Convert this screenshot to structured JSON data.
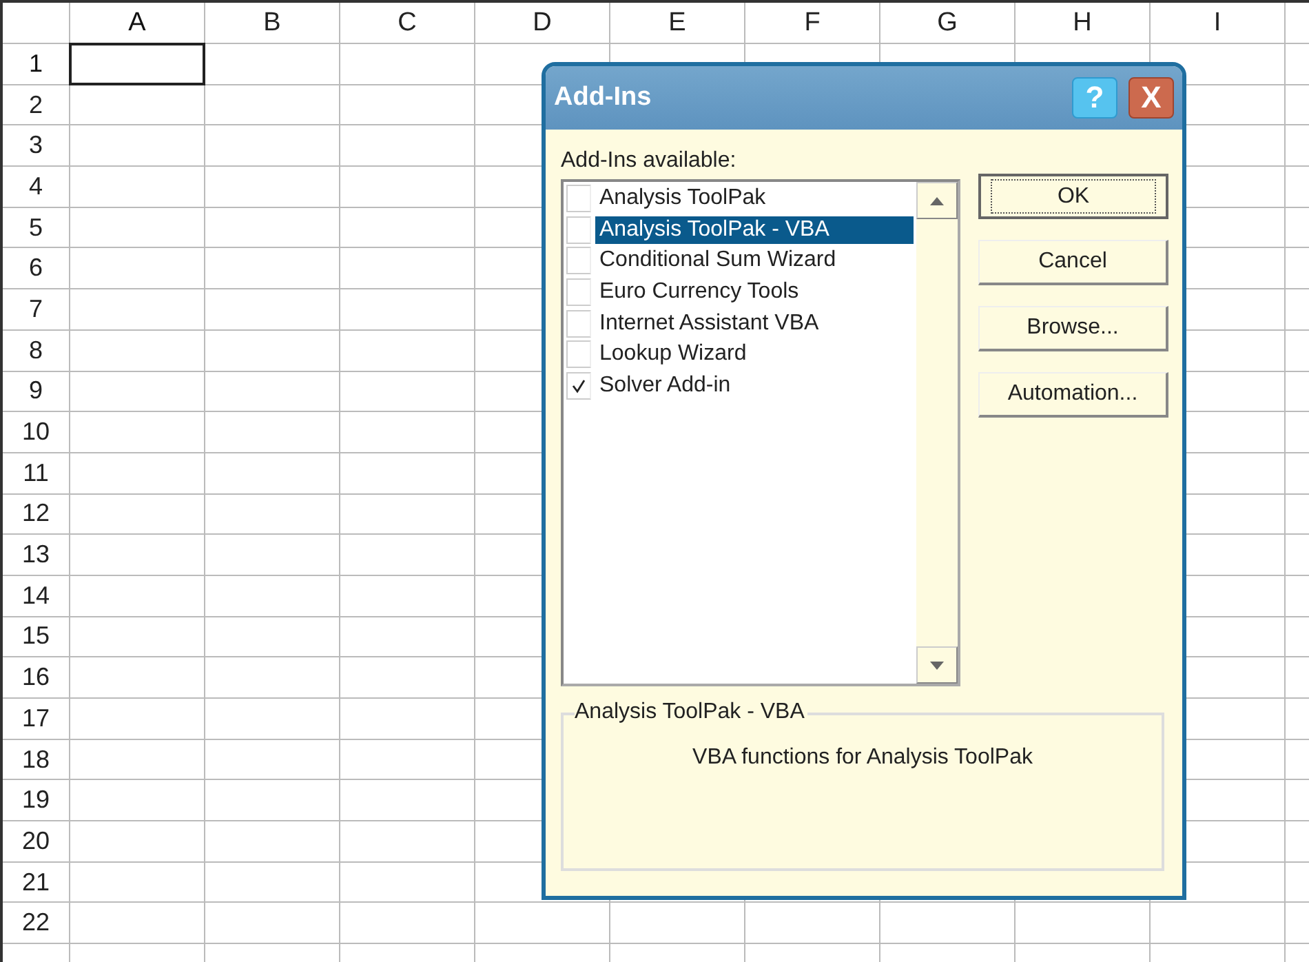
{
  "sheet": {
    "columns": [
      {
        "label": "A",
        "selected": true
      },
      {
        "label": "B",
        "selected": false
      },
      {
        "label": "C",
        "selected": false
      },
      {
        "label": "D",
        "selected": false
      },
      {
        "label": "E",
        "selected": false
      },
      {
        "label": "F",
        "selected": false
      },
      {
        "label": "G",
        "selected": false
      },
      {
        "label": "H",
        "selected": false
      },
      {
        "label": "I",
        "selected": false
      }
    ],
    "rows": [
      {
        "label": "1",
        "selected": true
      },
      {
        "label": "2",
        "selected": false
      },
      {
        "label": "3",
        "selected": false
      },
      {
        "label": "4",
        "selected": false
      },
      {
        "label": "5",
        "selected": false
      },
      {
        "label": "6",
        "selected": false
      },
      {
        "label": "7",
        "selected": false
      },
      {
        "label": "8",
        "selected": false
      },
      {
        "label": "9",
        "selected": false
      },
      {
        "label": "10",
        "selected": false
      },
      {
        "label": "11",
        "selected": false
      },
      {
        "label": "12",
        "selected": false
      },
      {
        "label": "13",
        "selected": false
      },
      {
        "label": "14",
        "selected": false
      },
      {
        "label": "15",
        "selected": false
      },
      {
        "label": "16",
        "selected": false
      },
      {
        "label": "17",
        "selected": false
      },
      {
        "label": "18",
        "selected": false
      },
      {
        "label": "19",
        "selected": false
      },
      {
        "label": "20",
        "selected": false
      },
      {
        "label": "21",
        "selected": false
      },
      {
        "label": "22",
        "selected": false
      }
    ]
  },
  "dialog": {
    "title": "Add-Ins",
    "help_button": "?",
    "close_button": "X",
    "list_label": "Add-Ins available:",
    "items": [
      {
        "label": "Analysis ToolPak",
        "checked": false,
        "selected": false
      },
      {
        "label": "Analysis ToolPak - VBA",
        "checked": false,
        "selected": true
      },
      {
        "label": "Conditional Sum Wizard",
        "checked": false,
        "selected": false
      },
      {
        "label": "Euro Currency Tools",
        "checked": false,
        "selected": false
      },
      {
        "label": "Internet Assistant VBA",
        "checked": false,
        "selected": false
      },
      {
        "label": "Lookup Wizard",
        "checked": false,
        "selected": false
      },
      {
        "label": "Solver Add-in",
        "checked": true,
        "selected": false
      }
    ],
    "buttons": [
      {
        "label": "OK",
        "default": true
      },
      {
        "label": "Cancel",
        "default": false
      },
      {
        "label": "Browse...",
        "default": false
      },
      {
        "label": "Automation...",
        "default": false
      }
    ],
    "details": {
      "title": "Analysis ToolPak - VBA",
      "description": "VBA functions for Analysis ToolPak"
    }
  }
}
